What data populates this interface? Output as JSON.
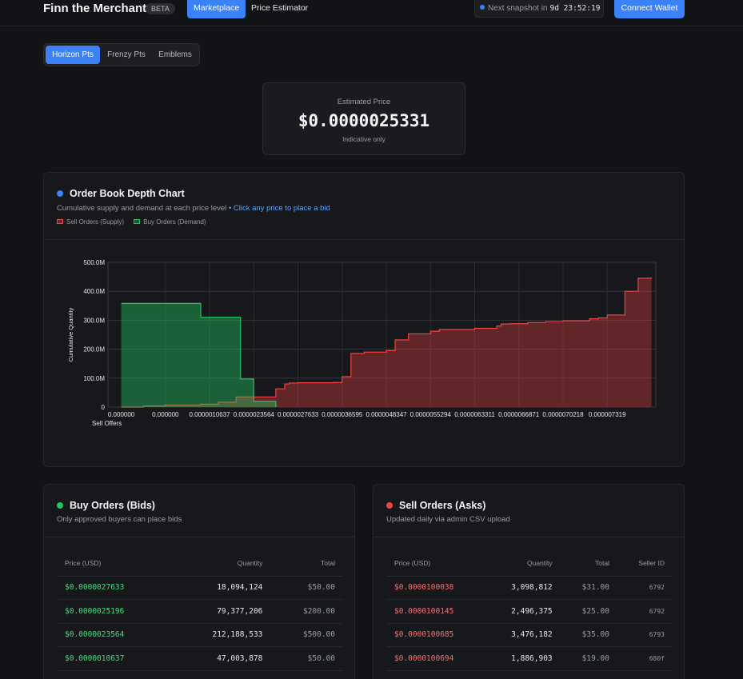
{
  "header": {
    "brand": "Finn the Merchant",
    "beta": "BETA",
    "nav": [
      "Marketplace",
      "Price Estimator"
    ],
    "snapshot_label": "Next snapshot in",
    "snapshot_timer": "9d 23:52:19",
    "connect_label": "Connect Wallet"
  },
  "tabs": [
    "Horizon Pts",
    "Frenzy Pts",
    "Emblems"
  ],
  "estimate": {
    "label": "Estimated Price",
    "value": "$0.0000025331",
    "note": "Indicative only"
  },
  "depth_panel": {
    "title": "Order Book Depth Chart",
    "subtitle": "Cumulative supply and demand at each price level",
    "subtitle_link": "• Click any price to place a bid",
    "legend_sell": "Sell Orders (Supply)",
    "legend_buy": "Buy Orders (Demand)",
    "colors": {
      "sell": "#ef4444",
      "buy": "#22c55e",
      "accent": "#3b82f6"
    }
  },
  "chart_data": {
    "type": "area",
    "ylabel": "Cumulative Quantity",
    "x_extra_label": "Sell Offers",
    "y_ticks": [
      "0",
      "100.0M",
      "200.0M",
      "300.0M",
      "400.0M",
      "500.0M"
    ],
    "ylim": [
      0,
      500
    ],
    "x_tick_labels": [
      "0.000000",
      "0.000000",
      "0.0000010637",
      "0.0000023564",
      "0.0000027633",
      "0.0000036595",
      "0.0000048347",
      "0.0000055294",
      "0.0000063311",
      "0.0000066871",
      "0.0000070218",
      "0.000007319"
    ],
    "series": [
      {
        "name": "Buy Orders (Demand)",
        "step_x": [
          0,
          1.8,
          2.7,
          3.0,
          3.5
        ],
        "step_y": [
          358,
          310,
          97,
          20,
          0
        ]
      },
      {
        "name": "Sell Orders (Supply)",
        "step_x": [
          0,
          0.5,
          1.0,
          1.8,
          2.2,
          2.6,
          3.5,
          3.7,
          3.8,
          4.0,
          4.6,
          4.8,
          5.0,
          5.2,
          5.5,
          6.0,
          6.2,
          6.5,
          7.0,
          7.2,
          7.5,
          8.0,
          8.5,
          8.6,
          8.8,
          9.2,
          9.4,
          9.6,
          10.0,
          10.6,
          10.8,
          11.0,
          11.4,
          11.7,
          12.0
        ],
        "step_y": [
          0,
          4,
          7,
          10,
          17,
          35,
          63,
          80,
          83,
          84,
          84,
          85,
          105,
          185,
          190,
          195,
          232,
          253,
          262,
          268,
          268,
          272,
          280,
          287,
          288,
          292,
          292,
          295,
          298,
          305,
          308,
          318,
          400,
          445,
          448
        ]
      }
    ]
  },
  "bids": {
    "title": "Buy Orders (Bids)",
    "subtitle": "Only approved buyers can place bids",
    "columns": [
      "Price (USD)",
      "Quantity",
      "Total"
    ],
    "rows": [
      [
        "$0.0000027633",
        "18,094,124",
        "$50.00"
      ],
      [
        "$0.0000025196",
        "79,377,206",
        "$200.00"
      ],
      [
        "$0.0000023564",
        "212,188,533",
        "$500.00"
      ],
      [
        "$0.0000010637",
        "47,003,878",
        "$50.00"
      ]
    ]
  },
  "asks": {
    "title": "Sell Orders (Asks)",
    "subtitle": "Updated daily via admin CSV upload",
    "columns": [
      "Price (USD)",
      "Quantity",
      "Total",
      "Seller ID"
    ],
    "rows": [
      [
        "$0.0000100038",
        "3,098,812",
        "$31.00",
        "6792"
      ],
      [
        "$0.0000100145",
        "2,496,375",
        "$25.00",
        "6792"
      ],
      [
        "$0.0000100685",
        "3,476,182",
        "$35.00",
        "6793"
      ],
      [
        "$0.0000100694",
        "1,886,903",
        "$19.00",
        "680f"
      ]
    ]
  }
}
